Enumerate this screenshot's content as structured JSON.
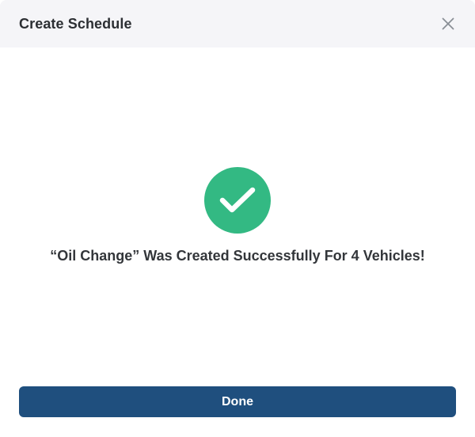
{
  "dialog": {
    "title": "Create Schedule",
    "close_icon": "close-icon"
  },
  "success": {
    "icon": "checkmark-icon",
    "message": "“Oil Change” Was Created Successfully For 4 Vehicles!"
  },
  "footer": {
    "done_label": "Done"
  },
  "colors": {
    "success": "#33b983",
    "primary": "#1f4f7e"
  }
}
